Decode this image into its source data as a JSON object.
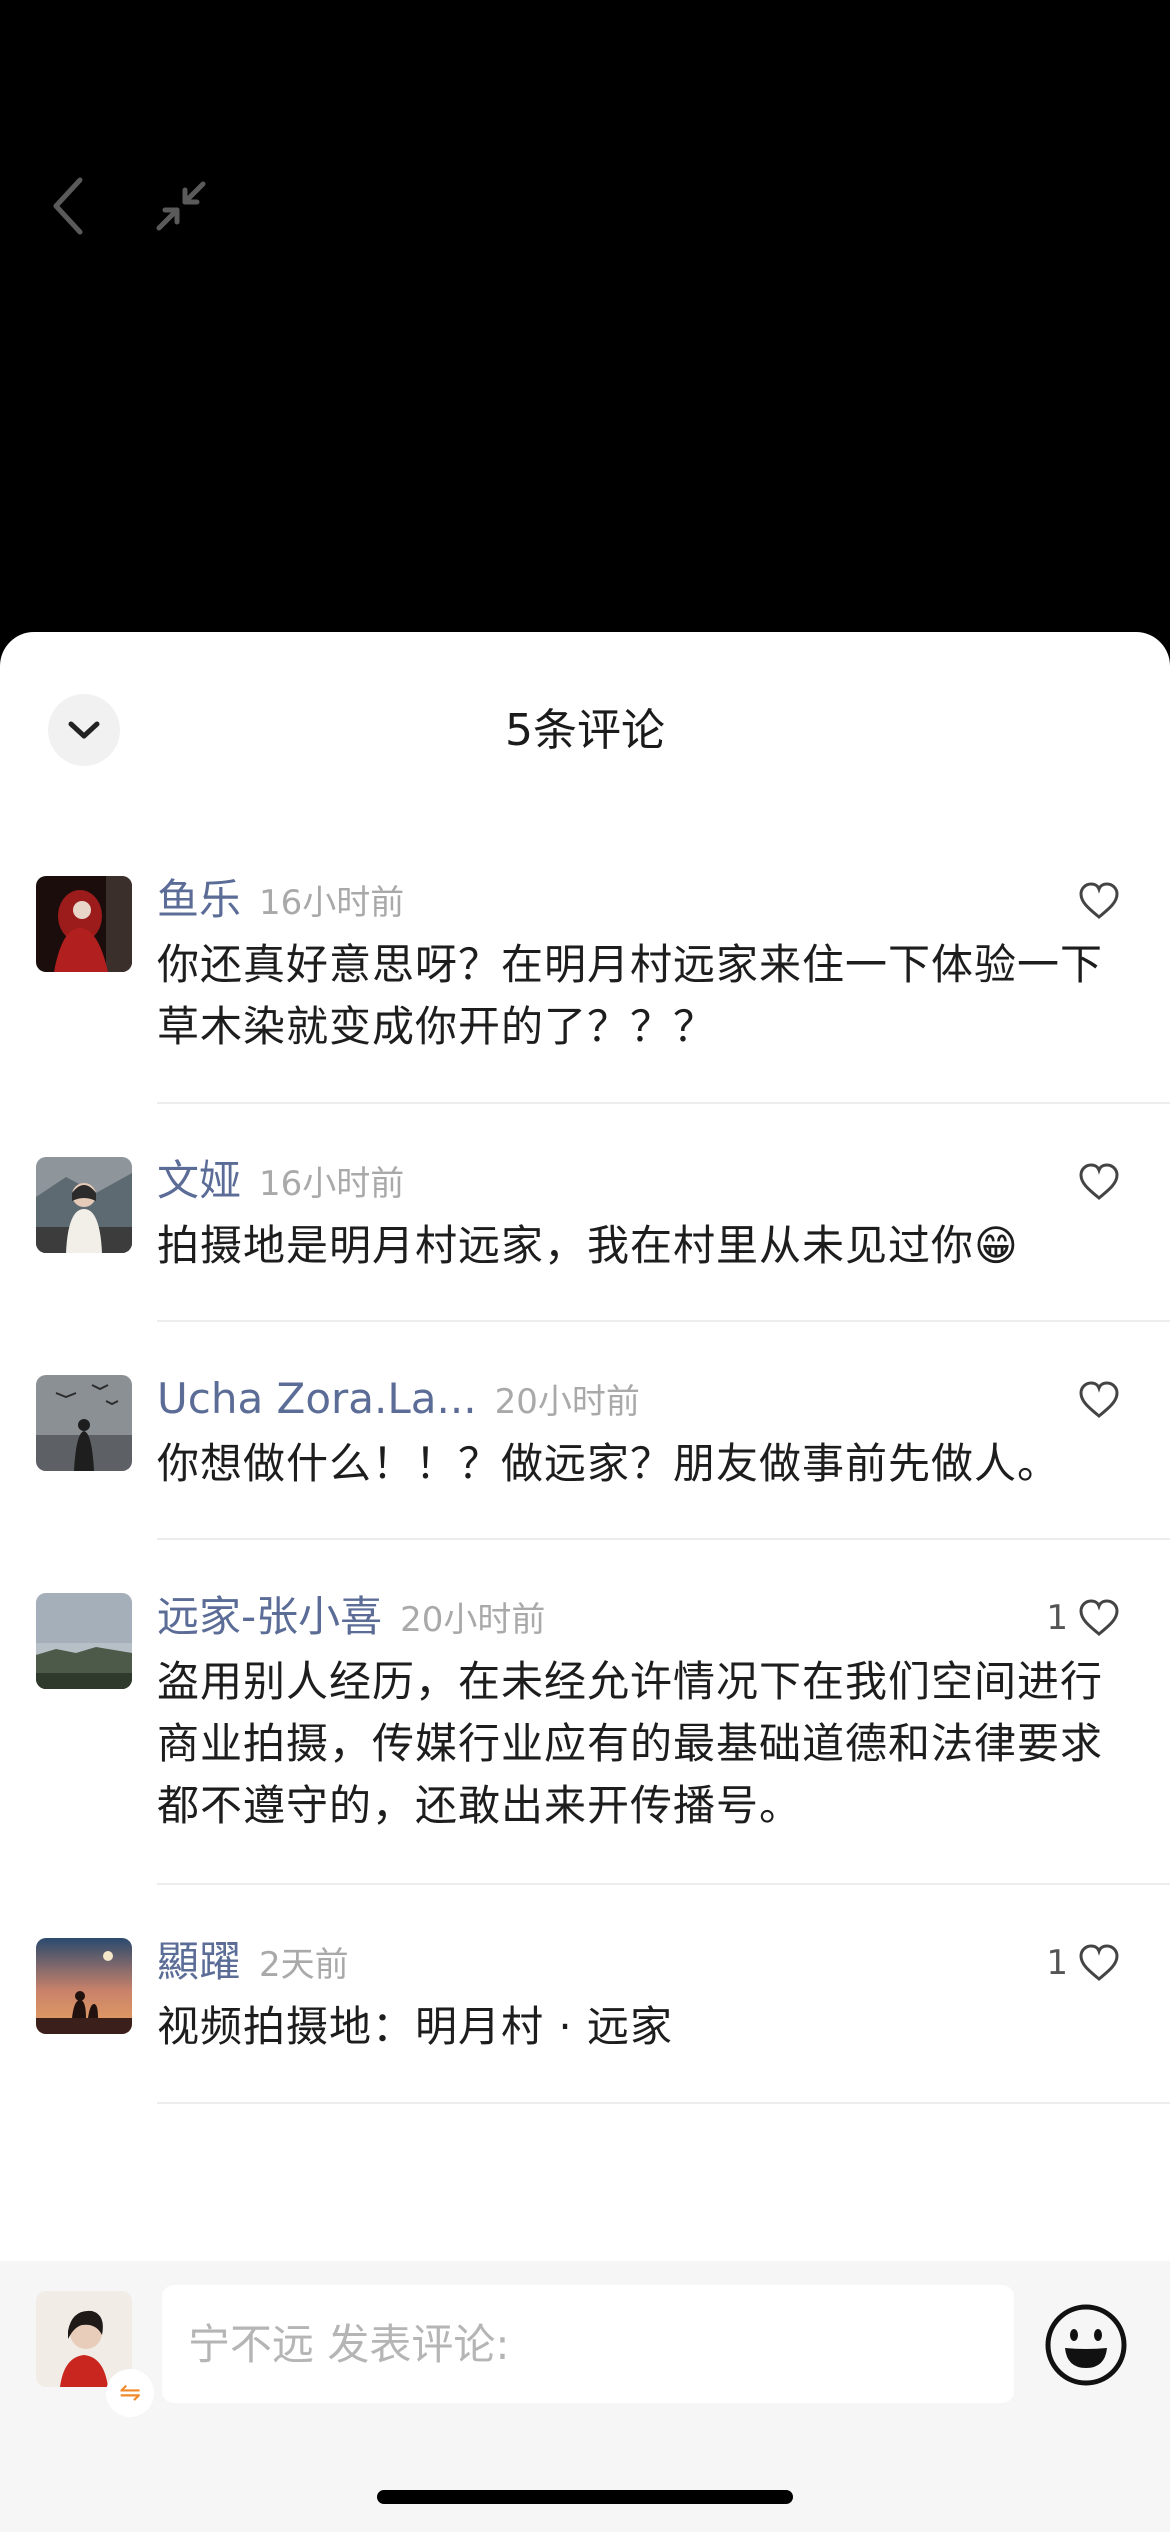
{
  "header": {
    "back_icon": "chevron-left-icon",
    "shrink_icon": "minimize-arrows-icon"
  },
  "sheet": {
    "title": "5条评论",
    "collapse_icon": "chevron-down-icon"
  },
  "comments": [
    {
      "author": "鱼乐",
      "time": "16小时前",
      "text": "你还真好意思呀？在明月村远家来住一下体验一下草木染就变成你开的了？？？",
      "likes": ""
    },
    {
      "author": "文娅",
      "time": "16小时前",
      "text": "拍摄地是明月村远家，我在村里从未见过你😁",
      "likes": ""
    },
    {
      "author": "Ucha Zora.La...",
      "time": "20小时前",
      "text": "你想做什么！！？做远家？朋友做事前先做人。",
      "likes": ""
    },
    {
      "author": "远家-张小喜",
      "time": "20小时前",
      "text": "盗用别人经历，在未经允许情况下在我们空间进行商业拍摄，传媒行业应有的最基础道德和法律要求都不遵守的，还敢出来开传播号。",
      "likes": "1"
    },
    {
      "author": "顯躍",
      "time": "2天前",
      "text": "视频拍摄地：明月村 · 远家",
      "likes": "1"
    }
  ],
  "footer": {
    "placeholder": "宁不远 发表评论:",
    "switch_glyph": "⇋",
    "emoji_icon": "smiley-emoji-icon"
  },
  "colors": {
    "author": "#5b6c97",
    "time": "#a9a9a9",
    "text": "#1d1d1d",
    "sheet_bg": "#ffffff",
    "backdrop": "#000000"
  }
}
